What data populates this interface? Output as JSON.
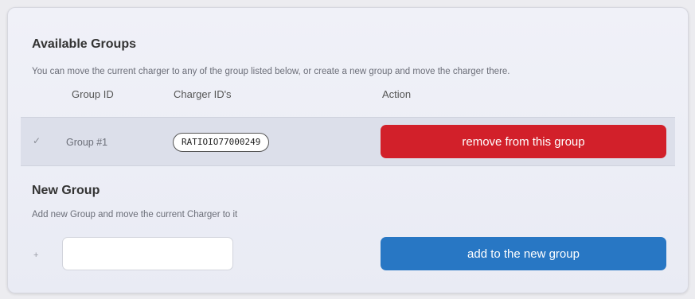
{
  "available": {
    "title": "Available Groups",
    "description": "You can move the current charger to any of the group listed below, or create a new group and move the charger there.",
    "columns": [
      "Group ID",
      "Charger ID's",
      "Action"
    ],
    "rows": [
      {
        "check_icon": "checkmark-icon",
        "check_glyph": "✓",
        "group_id": "Group #1",
        "charger_id": "RATIOIO77000249",
        "action_label": "remove from this group"
      }
    ]
  },
  "new_group": {
    "title": "New Group",
    "description": "Add new Group and move the current Charger to it",
    "plus_icon": "plus-icon",
    "plus_glyph": "+",
    "input_value": "",
    "input_placeholder": "",
    "action_label": "add to the new group"
  },
  "colors": {
    "remove_button": "#d2202a",
    "add_button": "#2877c4"
  }
}
